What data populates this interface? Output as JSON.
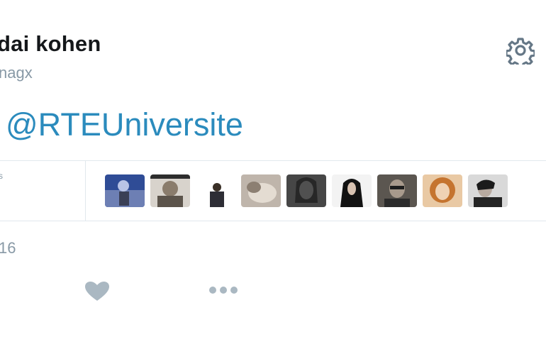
{
  "profile": {
    "name": "dai kohen",
    "handle": "nagx"
  },
  "tweet": {
    "mention": "@RTEUniversite"
  },
  "stats": {
    "fragment": "s"
  },
  "avatars": [
    "avatar-1",
    "avatar-2",
    "avatar-3",
    "avatar-4",
    "avatar-5",
    "avatar-6",
    "avatar-7",
    "avatar-8",
    "avatar-9"
  ],
  "timestamp": {
    "date": "16"
  },
  "icons": {
    "settings": "gear-icon",
    "like": "heart-icon",
    "more": "more-dots-icon"
  },
  "colors": {
    "mention": "#2b8bbd",
    "muted": "#8899a6",
    "icon": "#aab8c2"
  }
}
